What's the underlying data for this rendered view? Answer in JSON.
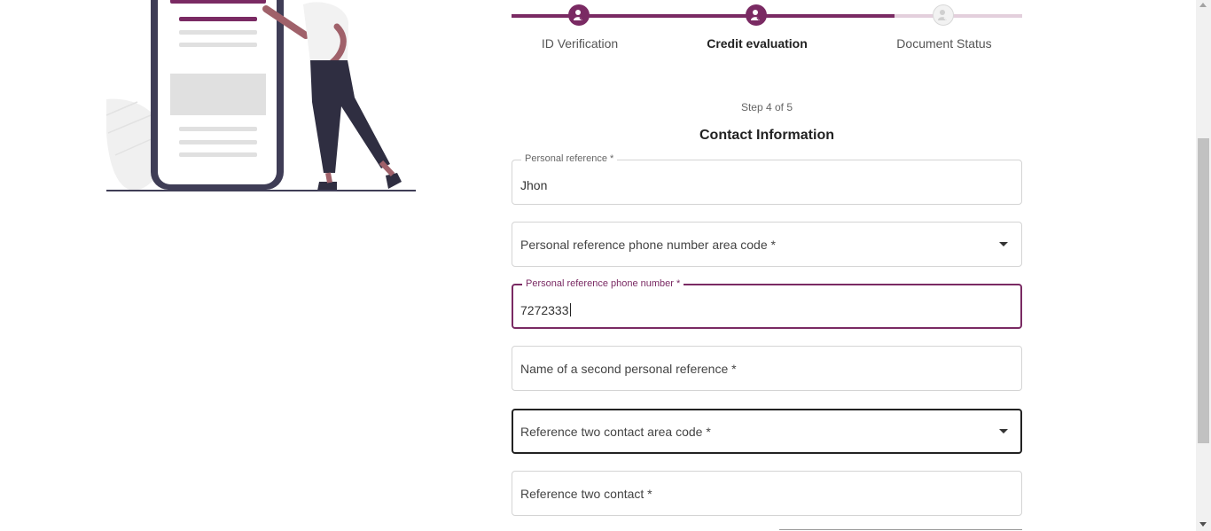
{
  "stepper": {
    "steps": [
      {
        "label": "ID Verification",
        "state": "done"
      },
      {
        "label": "Credit evaluation",
        "state": "current"
      },
      {
        "label": "Document Status",
        "state": "pending"
      }
    ],
    "progress": 0.75,
    "accent": "#7a2a63"
  },
  "step_counter": "Step 4 of 5",
  "section_title": "Contact Information",
  "fields": {
    "personal_reference": {
      "label": "Personal reference *",
      "value": "Jhon"
    },
    "personal_reference_area_code": {
      "placeholder": "Personal reference phone number area code *"
    },
    "personal_reference_phone": {
      "label": "Personal reference phone number *",
      "value": "7272333"
    },
    "second_reference_name": {
      "placeholder": "Name of a second personal reference *"
    },
    "reference_two_area_code": {
      "placeholder": "Reference two contact area code *"
    },
    "reference_two_contact": {
      "placeholder": "Reference two contact *"
    }
  },
  "icons": {
    "step_icon": "user-check-icon",
    "dropdown": "chevron-down-icon"
  }
}
